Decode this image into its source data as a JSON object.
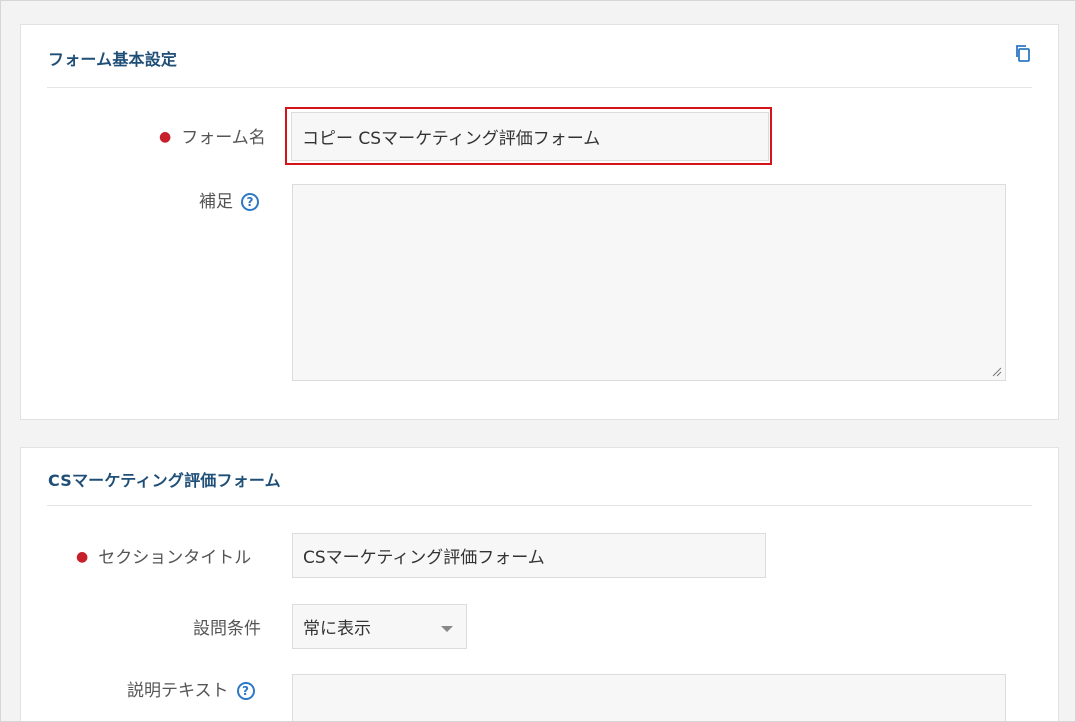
{
  "basic_settings": {
    "title": "フォーム基本設定",
    "copy_icon": "copy-icon",
    "form_name": {
      "label": "フォーム名",
      "required": true,
      "value": "コピー CSマーケティング評価フォーム"
    },
    "supplement": {
      "label": "補足",
      "help_icon": "question-circle-icon",
      "help_glyph": "?",
      "value": ""
    }
  },
  "section": {
    "title": "CSマーケティング評価フォーム",
    "section_title": {
      "label": "セクションタイトル",
      "required": true,
      "value": "CSマーケティング評価フォーム"
    },
    "question_condition": {
      "label": "設問条件",
      "selected": "常に表示"
    },
    "description": {
      "label": "説明テキスト",
      "help_icon": "question-circle-icon",
      "help_glyph": "?",
      "value": ""
    }
  },
  "colors": {
    "title": "#1f4f77",
    "required_dot": "#c8202a",
    "help_icon": "#2f78c5",
    "highlight_border": "#d4141b"
  }
}
